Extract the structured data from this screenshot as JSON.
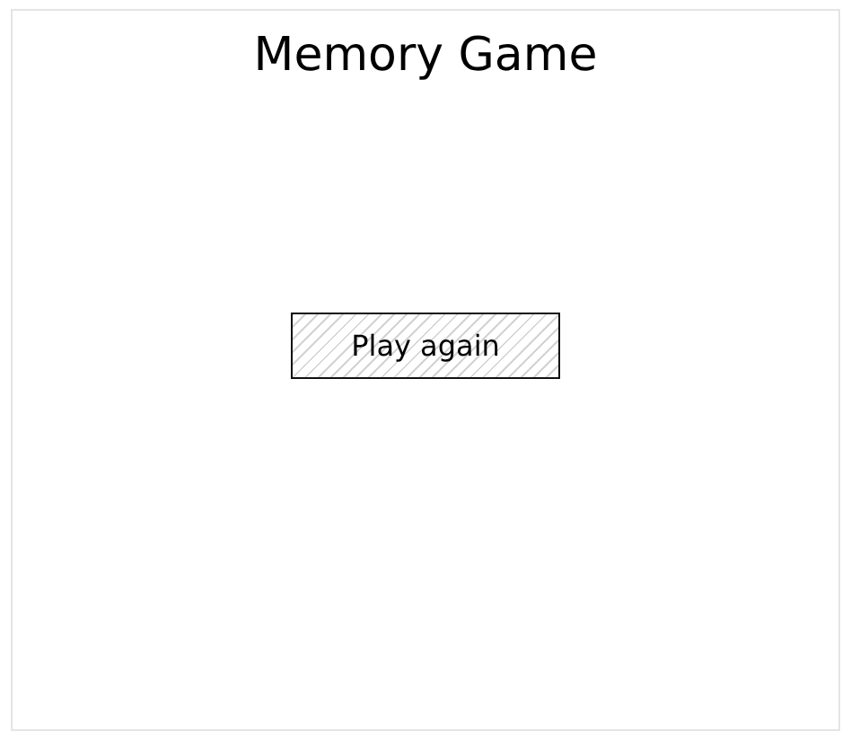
{
  "title": "Memory Game",
  "button": {
    "label": "Play again"
  }
}
